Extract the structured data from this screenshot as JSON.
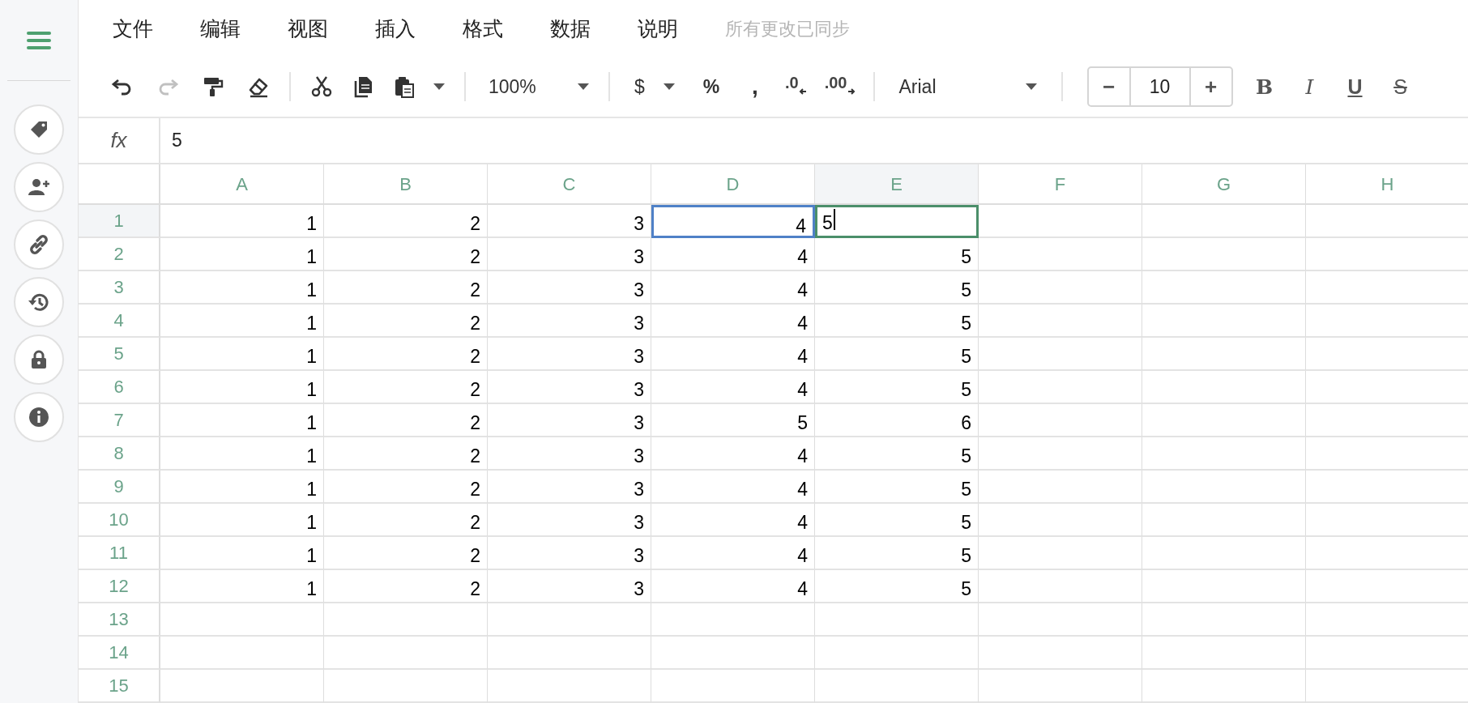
{
  "menu": [
    {
      "label": "文件"
    },
    {
      "label": "编辑"
    },
    {
      "label": "视图"
    },
    {
      "label": "插入"
    },
    {
      "label": "格式"
    },
    {
      "label": "数据"
    },
    {
      "label": "说明"
    }
  ],
  "sync_status": "所有更改已同步",
  "toolbar": {
    "undo": {
      "disabled": false
    },
    "redo": {
      "disabled": true
    },
    "zoom": "100%",
    "currency": "$",
    "percent": "%",
    "comma": ",",
    "decrease_decimal": ".0",
    "increase_decimal": ".00",
    "font": "Arial",
    "size_minus": "−",
    "font_size": "10",
    "size_plus": "+",
    "bold": "B",
    "italic": "I",
    "underline": "U",
    "strikethrough": "S"
  },
  "formula_bar": {
    "label": "fx",
    "value": "5"
  },
  "columns": [
    {
      "label": "A",
      "selected": false
    },
    {
      "label": "B",
      "selected": false
    },
    {
      "label": "C",
      "selected": false
    },
    {
      "label": "D",
      "selected": false
    },
    {
      "label": "E",
      "selected": true
    },
    {
      "label": "F",
      "selected": false
    },
    {
      "label": "G",
      "selected": false
    },
    {
      "label": "H",
      "selected": false
    }
  ],
  "rows": [
    {
      "label": "1",
      "selected": true,
      "cells": [
        {
          "value": "1",
          "highlighted": false,
          "editing": false
        },
        {
          "value": "2",
          "highlighted": false,
          "editing": false
        },
        {
          "value": "3",
          "highlighted": false,
          "editing": false
        },
        {
          "value": "4",
          "highlighted": true,
          "editing": false
        },
        {
          "value": "5",
          "highlighted": false,
          "editing": true
        }
      ]
    },
    {
      "label": "2",
      "selected": false,
      "cells": [
        {
          "value": "1",
          "highlighted": false,
          "editing": false
        },
        {
          "value": "2",
          "highlighted": false,
          "editing": false
        },
        {
          "value": "3",
          "highlighted": false,
          "editing": false
        },
        {
          "value": "4",
          "highlighted": false,
          "editing": false
        },
        {
          "value": "5",
          "highlighted": false,
          "editing": false
        }
      ]
    },
    {
      "label": "3",
      "selected": false,
      "cells": [
        {
          "value": "1",
          "highlighted": false,
          "editing": false
        },
        {
          "value": "2",
          "highlighted": false,
          "editing": false
        },
        {
          "value": "3",
          "highlighted": false,
          "editing": false
        },
        {
          "value": "4",
          "highlighted": false,
          "editing": false
        },
        {
          "value": "5",
          "highlighted": false,
          "editing": false
        }
      ]
    },
    {
      "label": "4",
      "selected": false,
      "cells": [
        {
          "value": "1",
          "highlighted": false,
          "editing": false
        },
        {
          "value": "2",
          "highlighted": false,
          "editing": false
        },
        {
          "value": "3",
          "highlighted": false,
          "editing": false
        },
        {
          "value": "4",
          "highlighted": false,
          "editing": false
        },
        {
          "value": "5",
          "highlighted": false,
          "editing": false
        }
      ]
    },
    {
      "label": "5",
      "selected": false,
      "cells": [
        {
          "value": "1",
          "highlighted": false,
          "editing": false
        },
        {
          "value": "2",
          "highlighted": false,
          "editing": false
        },
        {
          "value": "3",
          "highlighted": false,
          "editing": false
        },
        {
          "value": "4",
          "highlighted": false,
          "editing": false
        },
        {
          "value": "5",
          "highlighted": false,
          "editing": false
        }
      ]
    },
    {
      "label": "6",
      "selected": false,
      "cells": [
        {
          "value": "1",
          "highlighted": false,
          "editing": false
        },
        {
          "value": "2",
          "highlighted": false,
          "editing": false
        },
        {
          "value": "3",
          "highlighted": false,
          "editing": false
        },
        {
          "value": "4",
          "highlighted": false,
          "editing": false
        },
        {
          "value": "5",
          "highlighted": false,
          "editing": false
        }
      ]
    },
    {
      "label": "7",
      "selected": false,
      "cells": [
        {
          "value": "1",
          "highlighted": false,
          "editing": false
        },
        {
          "value": "2",
          "highlighted": false,
          "editing": false
        },
        {
          "value": "3",
          "highlighted": false,
          "editing": false
        },
        {
          "value": "5",
          "highlighted": false,
          "editing": false
        },
        {
          "value": "6",
          "highlighted": false,
          "editing": false
        }
      ]
    },
    {
      "label": "8",
      "selected": false,
      "cells": [
        {
          "value": "1",
          "highlighted": false,
          "editing": false
        },
        {
          "value": "2",
          "highlighted": false,
          "editing": false
        },
        {
          "value": "3",
          "highlighted": false,
          "editing": false
        },
        {
          "value": "4",
          "highlighted": false,
          "editing": false
        },
        {
          "value": "5",
          "highlighted": false,
          "editing": false
        }
      ]
    },
    {
      "label": "9",
      "selected": false,
      "cells": [
        {
          "value": "1",
          "highlighted": false,
          "editing": false
        },
        {
          "value": "2",
          "highlighted": false,
          "editing": false
        },
        {
          "value": "3",
          "highlighted": false,
          "editing": false
        },
        {
          "value": "4",
          "highlighted": false,
          "editing": false
        },
        {
          "value": "5",
          "highlighted": false,
          "editing": false
        }
      ]
    },
    {
      "label": "10",
      "selected": false,
      "cells": [
        {
          "value": "1",
          "highlighted": false,
          "editing": false
        },
        {
          "value": "2",
          "highlighted": false,
          "editing": false
        },
        {
          "value": "3",
          "highlighted": false,
          "editing": false
        },
        {
          "value": "4",
          "highlighted": false,
          "editing": false
        },
        {
          "value": "5",
          "highlighted": false,
          "editing": false
        }
      ]
    },
    {
      "label": "11",
      "selected": false,
      "cells": [
        {
          "value": "1",
          "highlighted": false,
          "editing": false
        },
        {
          "value": "2",
          "highlighted": false,
          "editing": false
        },
        {
          "value": "3",
          "highlighted": false,
          "editing": false
        },
        {
          "value": "4",
          "highlighted": false,
          "editing": false
        },
        {
          "value": "5",
          "highlighted": false,
          "editing": false
        }
      ]
    },
    {
      "label": "12",
      "selected": false,
      "cells": [
        {
          "value": "1",
          "highlighted": false,
          "editing": false
        },
        {
          "value": "2",
          "highlighted": false,
          "editing": false
        },
        {
          "value": "3",
          "highlighted": false,
          "editing": false
        },
        {
          "value": "4",
          "highlighted": false,
          "editing": false
        },
        {
          "value": "5",
          "highlighted": false,
          "editing": false
        }
      ]
    },
    {
      "label": "13",
      "selected": false
    },
    {
      "label": "14",
      "selected": false
    },
    {
      "label": "15",
      "selected": false
    }
  ]
}
